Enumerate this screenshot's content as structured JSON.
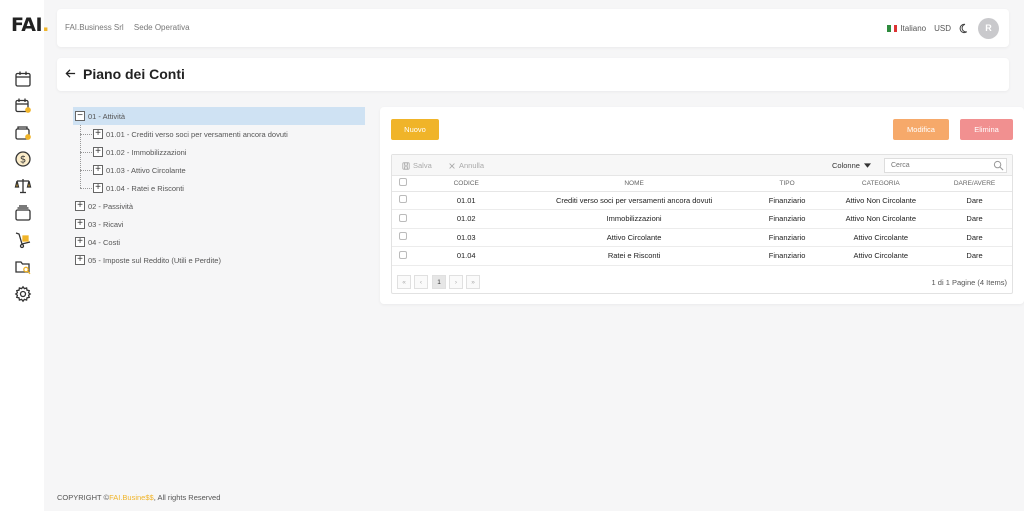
{
  "app": {
    "logo_text": "FAI",
    "logo_dot": ".",
    "accent_color": "#f0b429"
  },
  "sidebar": {
    "icons": [
      "calendar-icon",
      "calendar-user-icon",
      "wallet-icon",
      "dollar-coin-icon",
      "balance-scale-icon",
      "cards-icon",
      "dolly-icon",
      "folder-search-icon",
      "settings-icon"
    ]
  },
  "header": {
    "company": "FAI.Business Srl",
    "site": "Sede Operativa",
    "language": "Italiano",
    "currency": "USD",
    "avatar_initial": "R"
  },
  "page": {
    "title": "Piano dei Conti"
  },
  "tree": [
    {
      "label": "01 - Attività",
      "expanded": true,
      "selected": true,
      "children": [
        {
          "label": "01.01 - Crediti verso soci per versamenti ancora dovuti"
        },
        {
          "label": "01.02 - Immobilizzazioni"
        },
        {
          "label": "01.03 - Attivo Circolante"
        },
        {
          "label": "01.04 - Ratei e Risconti"
        }
      ]
    },
    {
      "label": "02 - Passività"
    },
    {
      "label": "03 - Ricavi"
    },
    {
      "label": "04 - Costi"
    },
    {
      "label": "05 - Imposte sul Reddito (Utili e Perdite)"
    }
  ],
  "actions": {
    "nuovo": "Nuovo",
    "modifica": "Modifica",
    "elimina": "Elimina"
  },
  "grid": {
    "toolbar": {
      "salva": "Salva",
      "annulla": "Annulla",
      "colonne": "Colonne",
      "search_placeholder": "Cerca"
    },
    "columns": [
      "CODICE",
      "NOME",
      "TIPO",
      "CATEGORIA",
      "DARE/AVERE"
    ],
    "rows": [
      [
        "01.01",
        "Crediti verso soci per versamenti ancora dovuti",
        "Finanziario",
        "Attivo Non Circolante",
        "Dare"
      ],
      [
        "01.02",
        "Immobilizzazioni",
        "Finanziario",
        "Attivo Non Circolante",
        "Dare"
      ],
      [
        "01.03",
        "Attivo Circolante",
        "Finanziario",
        "Attivo Circolante",
        "Dare"
      ],
      [
        "01.04",
        "Ratei e Risconti",
        "Finanziario",
        "Attivo Circolante",
        "Dare"
      ]
    ],
    "pager": {
      "first": "«",
      "prev": "‹",
      "current_page": "1",
      "next": "›",
      "last": "»",
      "info": "1 di 1 Pagine (4 Items)"
    }
  },
  "footer": {
    "prefix": "COPYRIGHT ©",
    "brand": "FAI.Busine$$",
    "suffix": ", All rights Reserved"
  }
}
